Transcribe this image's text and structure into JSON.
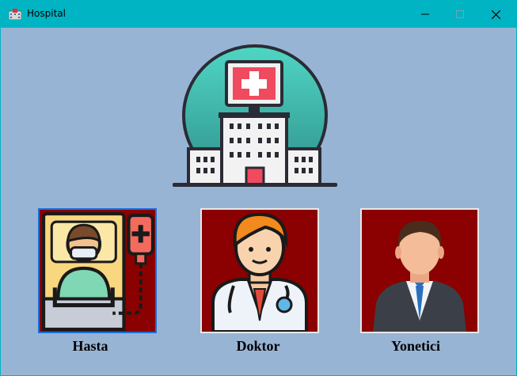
{
  "window": {
    "title": "Hospital",
    "app_icon": "hospital-icon",
    "controls": {
      "minimize": "minimize-icon",
      "maximize": "maximize-icon",
      "close": "close-icon"
    }
  },
  "logo": {
    "icon": "hospital-building-icon"
  },
  "roles": [
    {
      "label": "Hasta",
      "icon": "patient-icon",
      "selected": true
    },
    {
      "label": "Doktor",
      "icon": "doctor-icon",
      "selected": false
    },
    {
      "label": "Yonetici",
      "icon": "manager-icon",
      "selected": false
    }
  ],
  "colors": {
    "titlebar": "#00b4c4",
    "background": "#98b4d4",
    "card_background": "#8b0000",
    "selection_border": "#1e6fd9"
  }
}
